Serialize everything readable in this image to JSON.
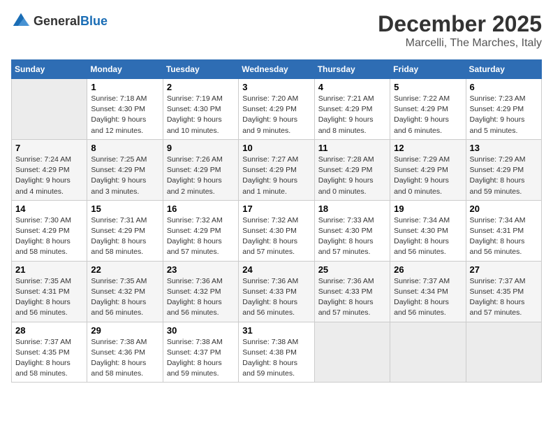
{
  "header": {
    "logo_general": "General",
    "logo_blue": "Blue",
    "month_title": "December 2025",
    "location": "Marcelli, The Marches, Italy"
  },
  "days_of_week": [
    "Sunday",
    "Monday",
    "Tuesday",
    "Wednesday",
    "Thursday",
    "Friday",
    "Saturday"
  ],
  "weeks": [
    [
      {
        "day": "",
        "sunrise": "",
        "sunset": "",
        "daylight": ""
      },
      {
        "day": "1",
        "sunrise": "7:18 AM",
        "sunset": "4:30 PM",
        "daylight": "9 hours and 12 minutes."
      },
      {
        "day": "2",
        "sunrise": "7:19 AM",
        "sunset": "4:30 PM",
        "daylight": "9 hours and 10 minutes."
      },
      {
        "day": "3",
        "sunrise": "7:20 AM",
        "sunset": "4:29 PM",
        "daylight": "9 hours and 9 minutes."
      },
      {
        "day": "4",
        "sunrise": "7:21 AM",
        "sunset": "4:29 PM",
        "daylight": "9 hours and 8 minutes."
      },
      {
        "day": "5",
        "sunrise": "7:22 AM",
        "sunset": "4:29 PM",
        "daylight": "9 hours and 6 minutes."
      },
      {
        "day": "6",
        "sunrise": "7:23 AM",
        "sunset": "4:29 PM",
        "daylight": "9 hours and 5 minutes."
      }
    ],
    [
      {
        "day": "7",
        "sunrise": "7:24 AM",
        "sunset": "4:29 PM",
        "daylight": "9 hours and 4 minutes."
      },
      {
        "day": "8",
        "sunrise": "7:25 AM",
        "sunset": "4:29 PM",
        "daylight": "9 hours and 3 minutes."
      },
      {
        "day": "9",
        "sunrise": "7:26 AM",
        "sunset": "4:29 PM",
        "daylight": "9 hours and 2 minutes."
      },
      {
        "day": "10",
        "sunrise": "7:27 AM",
        "sunset": "4:29 PM",
        "daylight": "9 hours and 1 minute."
      },
      {
        "day": "11",
        "sunrise": "7:28 AM",
        "sunset": "4:29 PM",
        "daylight": "9 hours and 0 minutes."
      },
      {
        "day": "12",
        "sunrise": "7:29 AM",
        "sunset": "4:29 PM",
        "daylight": "9 hours and 0 minutes."
      },
      {
        "day": "13",
        "sunrise": "7:29 AM",
        "sunset": "4:29 PM",
        "daylight": "8 hours and 59 minutes."
      }
    ],
    [
      {
        "day": "14",
        "sunrise": "7:30 AM",
        "sunset": "4:29 PM",
        "daylight": "8 hours and 58 minutes."
      },
      {
        "day": "15",
        "sunrise": "7:31 AM",
        "sunset": "4:29 PM",
        "daylight": "8 hours and 58 minutes."
      },
      {
        "day": "16",
        "sunrise": "7:32 AM",
        "sunset": "4:29 PM",
        "daylight": "8 hours and 57 minutes."
      },
      {
        "day": "17",
        "sunrise": "7:32 AM",
        "sunset": "4:30 PM",
        "daylight": "8 hours and 57 minutes."
      },
      {
        "day": "18",
        "sunrise": "7:33 AM",
        "sunset": "4:30 PM",
        "daylight": "8 hours and 57 minutes."
      },
      {
        "day": "19",
        "sunrise": "7:34 AM",
        "sunset": "4:30 PM",
        "daylight": "8 hours and 56 minutes."
      },
      {
        "day": "20",
        "sunrise": "7:34 AM",
        "sunset": "4:31 PM",
        "daylight": "8 hours and 56 minutes."
      }
    ],
    [
      {
        "day": "21",
        "sunrise": "7:35 AM",
        "sunset": "4:31 PM",
        "daylight": "8 hours and 56 minutes."
      },
      {
        "day": "22",
        "sunrise": "7:35 AM",
        "sunset": "4:32 PM",
        "daylight": "8 hours and 56 minutes."
      },
      {
        "day": "23",
        "sunrise": "7:36 AM",
        "sunset": "4:32 PM",
        "daylight": "8 hours and 56 minutes."
      },
      {
        "day": "24",
        "sunrise": "7:36 AM",
        "sunset": "4:33 PM",
        "daylight": "8 hours and 56 minutes."
      },
      {
        "day": "25",
        "sunrise": "7:36 AM",
        "sunset": "4:33 PM",
        "daylight": "8 hours and 57 minutes."
      },
      {
        "day": "26",
        "sunrise": "7:37 AM",
        "sunset": "4:34 PM",
        "daylight": "8 hours and 56 minutes."
      },
      {
        "day": "27",
        "sunrise": "7:37 AM",
        "sunset": "4:35 PM",
        "daylight": "8 hours and 57 minutes."
      }
    ],
    [
      {
        "day": "28",
        "sunrise": "7:37 AM",
        "sunset": "4:35 PM",
        "daylight": "8 hours and 58 minutes."
      },
      {
        "day": "29",
        "sunrise": "7:38 AM",
        "sunset": "4:36 PM",
        "daylight": "8 hours and 58 minutes."
      },
      {
        "day": "30",
        "sunrise": "7:38 AM",
        "sunset": "4:37 PM",
        "daylight": "8 hours and 59 minutes."
      },
      {
        "day": "31",
        "sunrise": "7:38 AM",
        "sunset": "4:38 PM",
        "daylight": "8 hours and 59 minutes."
      },
      {
        "day": "",
        "sunrise": "",
        "sunset": "",
        "daylight": ""
      },
      {
        "day": "",
        "sunrise": "",
        "sunset": "",
        "daylight": ""
      },
      {
        "day": "",
        "sunrise": "",
        "sunset": "",
        "daylight": ""
      }
    ]
  ]
}
